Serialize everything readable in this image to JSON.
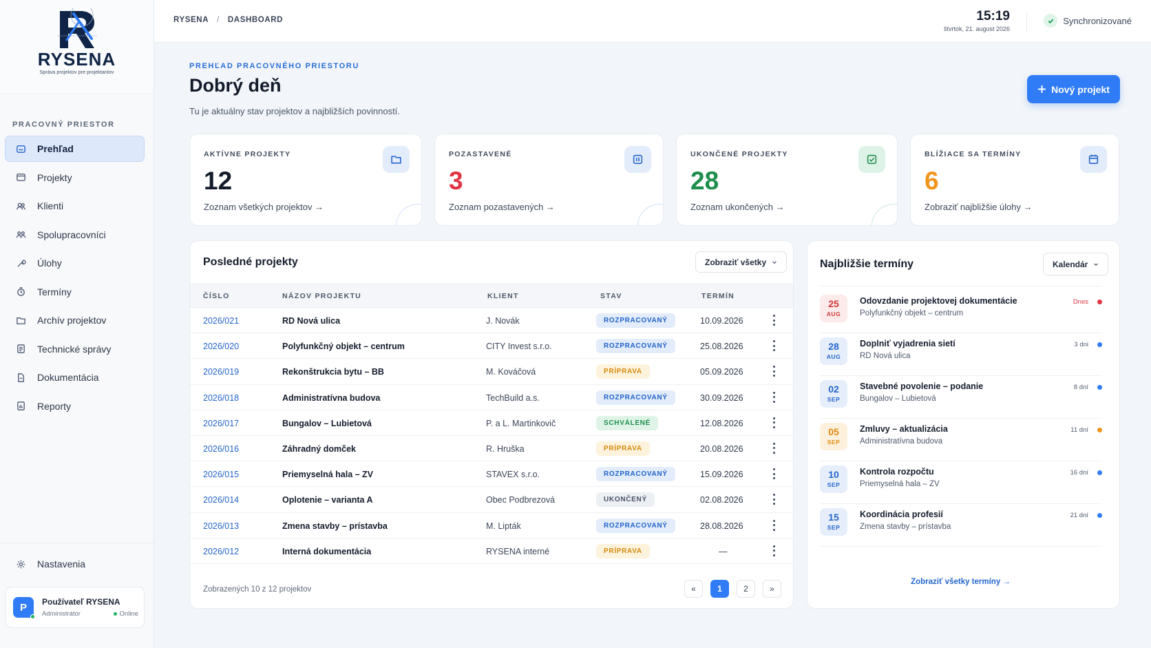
{
  "brand": {
    "name": "RYSENA",
    "tagline": "Správa projektov pre projektantov"
  },
  "sidebar": {
    "section_title": "PRACOVNÝ PRIESTOR",
    "items": [
      {
        "label": "Prehľad",
        "icon": "home-icon",
        "active": true
      },
      {
        "label": "Projekty",
        "icon": "folder-icon"
      },
      {
        "label": "Klienti",
        "icon": "users-icon"
      },
      {
        "label": "Spolupracovníci",
        "icon": "team-icon"
      },
      {
        "label": "Úlohy",
        "icon": "wrench-icon"
      },
      {
        "label": "Termíny",
        "icon": "clock-icon"
      },
      {
        "label": "Archív projektov",
        "icon": "archive-icon"
      },
      {
        "label": "Technické správy",
        "icon": "document-icon"
      },
      {
        "label": "Dokumentácia",
        "icon": "file-icon"
      },
      {
        "label": "Reporty",
        "icon": "report-icon"
      }
    ],
    "settings_label": "Nastavenia",
    "user": {
      "initial": "P",
      "name": "Používateľ RYSENA",
      "role": "Administrátor",
      "status": "Online"
    }
  },
  "topbar": {
    "breadcrumb": [
      "RYSENA",
      "/",
      "DASHBOARD"
    ],
    "time": "15:19",
    "date": "štvrtok, 21. august 2026",
    "sync_label": "Synchronizované"
  },
  "header": {
    "eyebrow": "PREHĽAD PRACOVNÉHO PRIESTORU",
    "title": "Dobrý deň",
    "subtitle": "Tu je aktuálny stav projektov a najbližších povinností.",
    "new_project_label": "Nový projekt"
  },
  "stats": [
    {
      "label": "AKTÍVNE PROJEKTY",
      "value": "12",
      "link": "Zoznam všetkých projektov →",
      "icon": "folder-icon",
      "color": "#141c2c"
    },
    {
      "label": "POZASTAVENÉ",
      "value": "3",
      "link": "Zoznam pozastavených →",
      "icon": "pause-icon",
      "color": "#e03444"
    },
    {
      "label": "UKONČENÉ PROJEKTY",
      "value": "28",
      "link": "Zoznam ukončených →",
      "icon": "check-icon",
      "color": "#1d8e4c"
    },
    {
      "label": "BLÍŽIACE SA TERMÍNY",
      "value": "6",
      "link": "Zobraziť najbližšie úlohy →",
      "icon": "calendar-icon",
      "color": "#f0951b"
    }
  ],
  "recent": {
    "title": "Posledné projekty",
    "filter_label": "Zobraziť všetky",
    "columns": [
      "ČÍSLO",
      "NÁZOV PROJEKTU",
      "KLIENT",
      "STAV",
      "TERMÍN"
    ],
    "rows": [
      {
        "num": "2026/021",
        "name": "RD Nová ulica",
        "client": "J. Novák",
        "status": "ROZPRACOVANÝ",
        "kind": "rozp",
        "date": "10.09.2026"
      },
      {
        "num": "2026/020",
        "name": "Polyfunkčný objekt – centrum",
        "client": "CITY Invest s.r.o.",
        "status": "ROZPRACOVANÝ",
        "kind": "rozp",
        "date": "25.08.2026"
      },
      {
        "num": "2026/019",
        "name": "Rekonštrukcia bytu – BB",
        "client": "M. Kováčová",
        "status": "PRÍPRAVA",
        "kind": "prip",
        "date": "05.09.2026"
      },
      {
        "num": "2026/018",
        "name": "Administratívna budova",
        "client": "TechBuild a.s.",
        "status": "ROZPRACOVANÝ",
        "kind": "rozp",
        "date": "30.09.2026"
      },
      {
        "num": "2026/017",
        "name": "Bungalov – Lubietová",
        "client": "P. a L. Martinkovič",
        "status": "SCHVÁLENÉ",
        "kind": "schv",
        "date": "12.08.2026"
      },
      {
        "num": "2026/016",
        "name": "Záhradný domček",
        "client": "R. Hruška",
        "status": "PRÍPRAVA",
        "kind": "prip",
        "date": "20.08.2026"
      },
      {
        "num": "2026/015",
        "name": "Priemyselná hala – ZV",
        "client": "STAVEX s.r.o.",
        "status": "ROZPRACOVANÝ",
        "kind": "rozp",
        "date": "15.09.2026"
      },
      {
        "num": "2026/014",
        "name": "Oplotenie – varianta A",
        "client": "Obec Podbrezová",
        "status": "UKONČENÝ",
        "kind": "ukon",
        "date": "02.08.2026"
      },
      {
        "num": "2026/013",
        "name": "Zmena stavby – prístavba",
        "client": "M. Lipták",
        "status": "ROZPRACOVANÝ",
        "kind": "rozp",
        "date": "28.08.2026"
      },
      {
        "num": "2026/012",
        "name": "Interná dokumentácia",
        "client": "RYSENA interné",
        "status": "PRÍPRAVA",
        "kind": "prip",
        "date": "—"
      }
    ],
    "footer": "Zobrazených 10 z 12 projektov",
    "pager": [
      "«",
      "1",
      "2",
      "»"
    ],
    "current_page": "1"
  },
  "deadlines": {
    "title": "Najbližšie termíny",
    "view_label": "Kalendár",
    "items": [
      {
        "day": "25",
        "month": "AUG",
        "title": "Odovzdanie projektovej dokumentácie",
        "project": "Polyfunkčný objekt – centrum",
        "when": "Dnes",
        "tone": "red"
      },
      {
        "day": "28",
        "month": "AUG",
        "title": "Doplniť vyjadrenia sietí",
        "project": "RD Nová ulica",
        "when": "3 dni",
        "tone": "blue"
      },
      {
        "day": "02",
        "month": "SEP",
        "title": "Stavebné povolenie – podanie",
        "project": "Bungalov – Lubietová",
        "when": "8 dní",
        "tone": "blue"
      },
      {
        "day": "05",
        "month": "SEP",
        "title": "Zmluvy – aktualizácia",
        "project": "Administratívna budova",
        "when": "11 dní",
        "tone": "orange"
      },
      {
        "day": "10",
        "month": "SEP",
        "title": "Kontrola rozpočtu",
        "project": "Priemyselná hala – ZV",
        "when": "16 dní",
        "tone": "blue"
      },
      {
        "day": "15",
        "month": "SEP",
        "title": "Koordinácia profesií",
        "project": "Zmena stavby – prístavba",
        "when": "21 dní",
        "tone": "blue"
      }
    ],
    "all_link": "Zobraziť všetky termíny →"
  },
  "colors": {
    "accent": "#2f7cf6",
    "red": "#e03444",
    "orange": "#f0951b",
    "green": "#1d8e4c",
    "blue": "#2566cc"
  }
}
